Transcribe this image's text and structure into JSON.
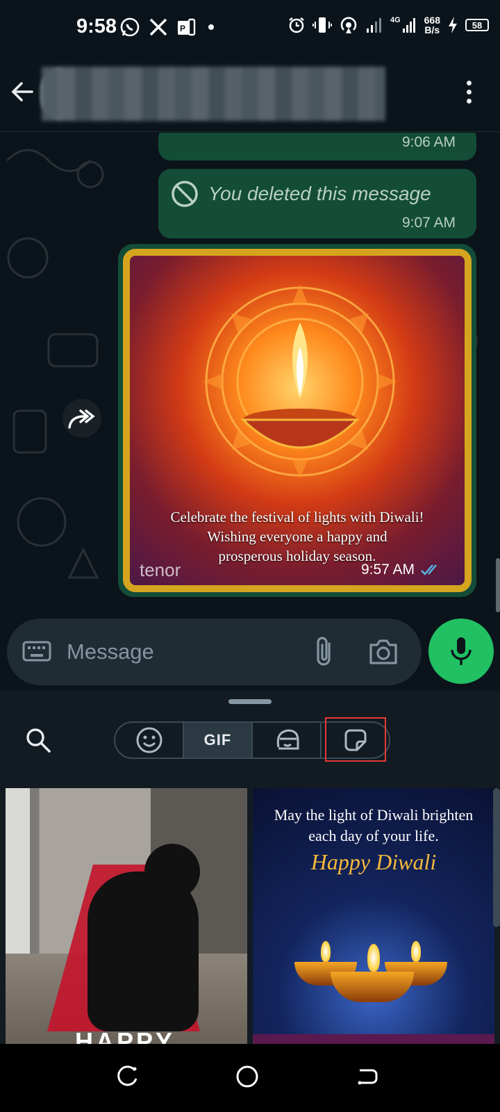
{
  "status_bar": {
    "time": "9:58",
    "network_speed_top": "668",
    "network_speed_bottom": "B/s",
    "network_type": "4G",
    "battery": "58",
    "icons": [
      "whatsapp-icon",
      "x-icon",
      "messaging-icon",
      "dot-icon",
      "alarm-icon",
      "vibrate-icon",
      "hotspot-icon",
      "signal-icon",
      "signal-4g-icon",
      "charging-icon",
      "battery-icon"
    ]
  },
  "header": {
    "contact_name_redacted": true
  },
  "messages": [
    {
      "type": "text",
      "time": "9:06 AM"
    },
    {
      "type": "deleted",
      "text": "You deleted this message",
      "time": "9:07 AM"
    },
    {
      "type": "gif",
      "caption_lines": [
        "Celebrate the festival of lights with Diwali!",
        "Wishing everyone a happy and",
        "prosperous holiday season."
      ],
      "source": "tenor",
      "time": "9:57 AM",
      "status": "read"
    }
  ],
  "composer": {
    "placeholder": "Message"
  },
  "picker": {
    "tabs": [
      {
        "name": "emoji",
        "icon": "emoji-icon",
        "active": false
      },
      {
        "name": "gif",
        "label": "GIF",
        "active": true
      },
      {
        "name": "avatar",
        "icon": "avatar-sticker-icon",
        "active": false
      },
      {
        "name": "sticker",
        "icon": "sticker-icon",
        "active": false,
        "highlighted": true
      }
    ],
    "results": [
      {
        "name": "cat-vampire-gif",
        "partial_text": "HAPPY"
      },
      {
        "name": "diwali-gif",
        "lines": [
          "May the light of Diwali brighten",
          "each day of your life."
        ],
        "script": "Happy Diwali"
      }
    ]
  },
  "colors": {
    "background": "#0b141a",
    "bubble_out": "#144d37",
    "accent_green": "#21c063",
    "panel": "#121b22",
    "highlight": "#e53935",
    "read_ticks": "#53bdeb"
  }
}
